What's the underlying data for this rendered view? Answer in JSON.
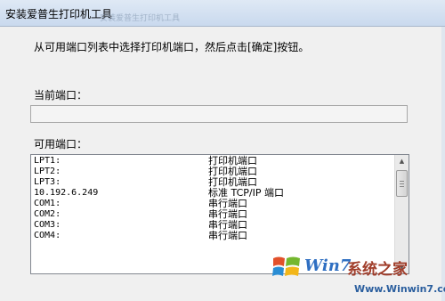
{
  "window": {
    "title": "安装爱普生打印机工具",
    "ghost_title": "安装爱普生打印机工具"
  },
  "dialog": {
    "instruction": "从可用端口列表中选择打印机端口，然后点击[确定]按钮。",
    "current_port_label": "当前端口：",
    "current_port_value": "",
    "available_ports_label": "可用端口："
  },
  "ports": [
    {
      "port": "LPT1:",
      "description": "打印机端口"
    },
    {
      "port": "LPT2:",
      "description": "打印机端口"
    },
    {
      "port": "LPT3:",
      "description": "打印机端口"
    },
    {
      "port": "10.192.6.249",
      "description": "标准 TCP/IP 端口"
    },
    {
      "port": "COM1:",
      "description": "串行端口"
    },
    {
      "port": "COM2:",
      "description": "串行端口"
    },
    {
      "port": "COM3:",
      "description": "串行端口"
    },
    {
      "port": "COM4:",
      "description": "串行端口"
    }
  ],
  "scrollbar": {
    "up_icon": "scroll-up-arrow",
    "down_icon": "scroll-down-arrow"
  },
  "watermark": {
    "brand": "Win7",
    "cn_text": "系统之家",
    "url": "Www.Winwin7.com"
  }
}
